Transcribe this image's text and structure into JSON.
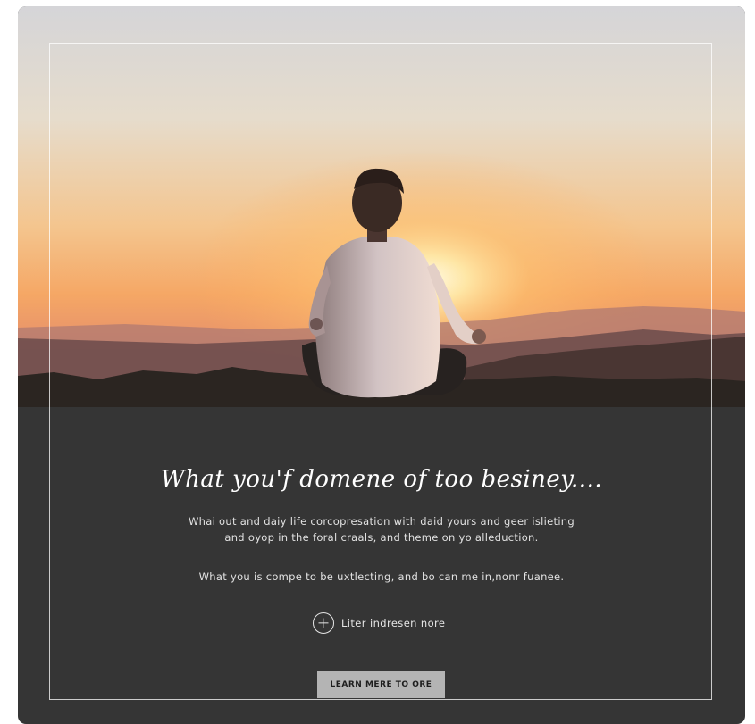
{
  "hero": {
    "image": "person meditating in lotus pose facing the sunset over mountains",
    "colors": {
      "sky_top": "#d9d9dc",
      "sky_mid": "#f2d2a8",
      "sun_glow": "#fff3c8",
      "horizon": "#f3a45c",
      "ground": "#2a2420"
    }
  },
  "content": {
    "headline": "What you'f domene of too besiney....",
    "body_line1": "Whai out and daiy life corcopresation with daid yours and geer islieting",
    "body_line2": "and oyop in the foral craals, and theme on yo alleduction.",
    "body_paragraph2": "What you is compe to be uxtlecting, and bo can me in,nonr fuanee.",
    "more_link_label": "Liter indresen nore",
    "more_link_icon": "plus-circle-icon",
    "cta_label": "LEARN MERE TO ORE"
  },
  "colors": {
    "panel_bg": "#353535",
    "text": "#e6e6e6",
    "button_bg": "#b4b4b4",
    "button_text": "#1e1e1e"
  }
}
